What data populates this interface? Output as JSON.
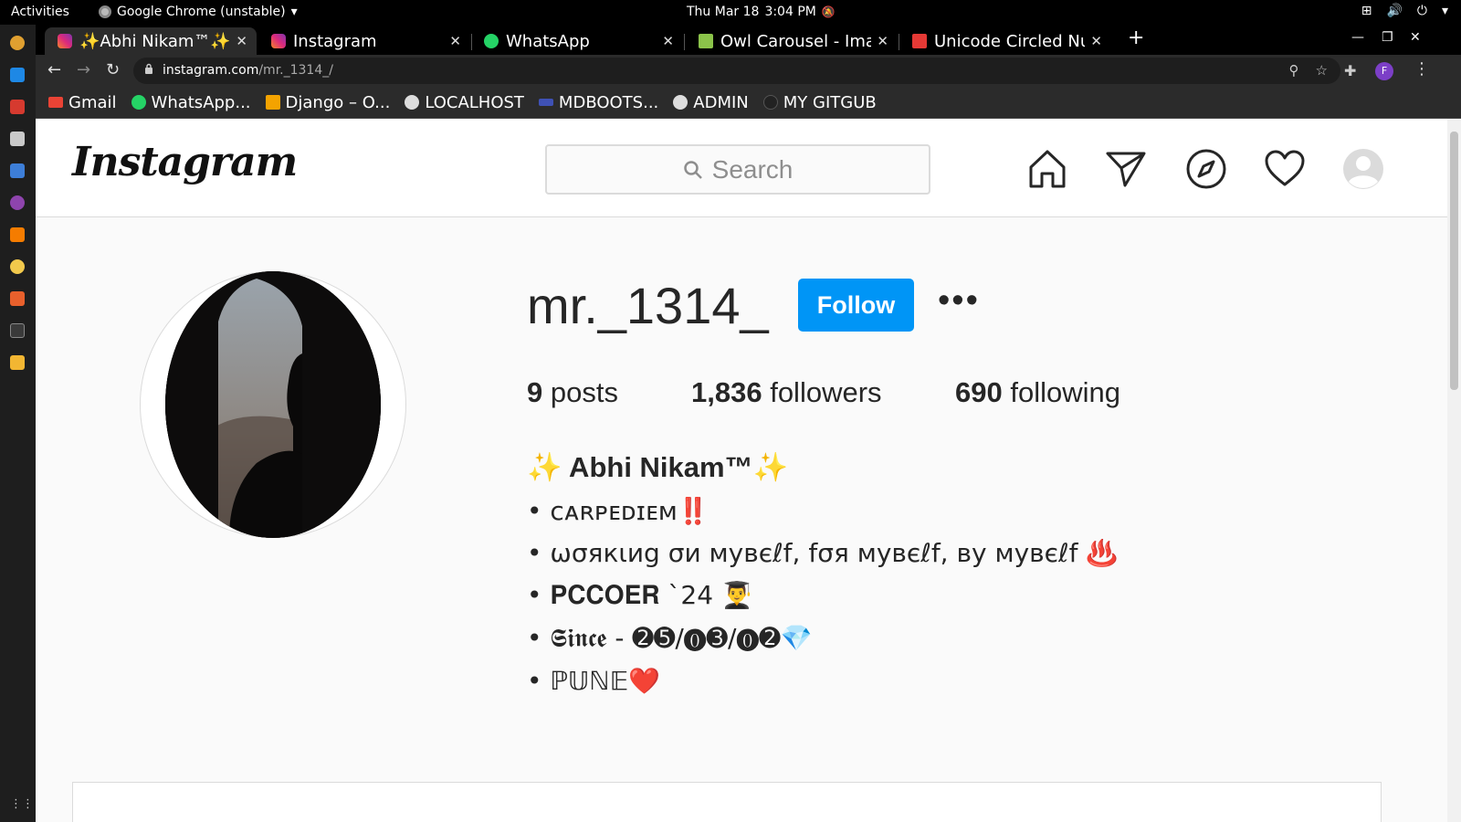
{
  "system_bar": {
    "activities": "Activities",
    "app_name": "Google Chrome (unstable)",
    "date": "Thu Mar 18",
    "time": "3:04 PM"
  },
  "tabs": [
    {
      "title": "✨Abhi Nikam™✨ (@",
      "favicon": "instagram-icon",
      "active": true
    },
    {
      "title": "Instagram",
      "favicon": "instagram-icon",
      "active": false
    },
    {
      "title": "WhatsApp",
      "favicon": "whatsapp-icon",
      "active": false
    },
    {
      "title": "Owl Carousel - Imag",
      "favicon": "owl-icon",
      "active": false
    },
    {
      "title": "Unicode Circled Nun",
      "favicon": "unicode-icon",
      "active": false
    }
  ],
  "address_bar": {
    "host": "instagram.com",
    "path": "/mr._1314_/"
  },
  "profile_initial": "F",
  "bookmarks": [
    {
      "label": "Gmail",
      "icon": "gmail-icon"
    },
    {
      "label": "WhatsApp...",
      "icon": "whatsapp-icon"
    },
    {
      "label": "Django – O...",
      "icon": "django-icon"
    },
    {
      "label": "LOCALHOST",
      "icon": "globe-icon"
    },
    {
      "label": "MDBOOTS...",
      "icon": "mdb-icon"
    },
    {
      "label": "ADMIN",
      "icon": "globe-icon"
    },
    {
      "label": "MY GITGUB",
      "icon": "github-icon"
    }
  ],
  "instagram": {
    "logo": "Instagram",
    "search_placeholder": "Search",
    "nav_icons": [
      "home-icon",
      "direct-message-icon",
      "explore-icon",
      "activity-heart-icon",
      "profile-avatar-icon"
    ]
  },
  "profile": {
    "username": "mr._1314_",
    "follow_label": "Follow",
    "more_label": "•••",
    "stats": {
      "posts_count": "9",
      "posts_label": "posts",
      "followers_count": "1,836",
      "followers_label": "followers",
      "following_count": "690",
      "following_label": "following"
    },
    "full_name": "✨ Abhi Nikam™✨",
    "bio": [
      "• ᴄᴀʀᴘᴇᴅɪᴇᴍ‼️",
      "• ωσякιиg σи мувєℓf, fσя мувєℓf, ву мувєℓf ♨️",
      "• 𝐏𝐂𝐂𝐎𝐄𝐑 `24 👨‍🎓",
      "• 𝕾𝖎𝖓𝖈𝖊 - ➋➎/⓿➌/⓿➋💎",
      "• ℙ𝕌ℕ𝔼❤️"
    ]
  },
  "colors": {
    "follow_button": "#0095f6",
    "page_bg": "#fafafa",
    "chrome_dark": "#2b2b2b"
  }
}
